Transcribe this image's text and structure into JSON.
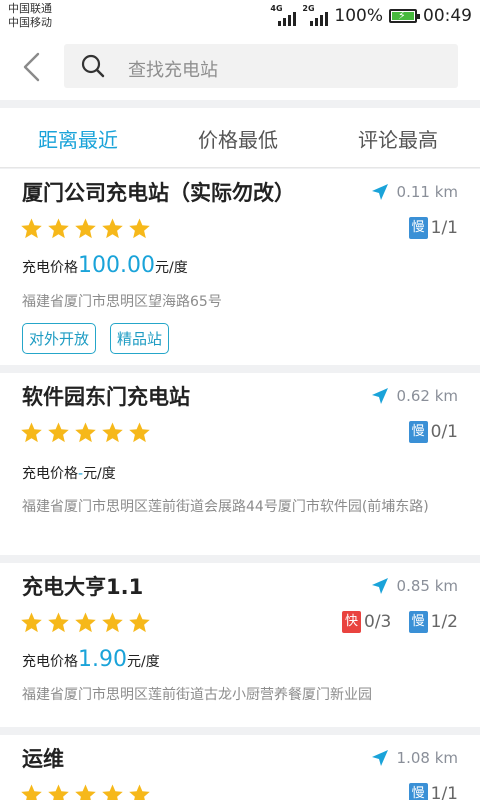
{
  "status_bar": {
    "carrier_1": "中国联通",
    "carrier_2": "中国移动",
    "net_1": "4G",
    "net_2": "2G",
    "battery": "100%",
    "time": "00:49"
  },
  "header": {
    "search_placeholder": "查找充电站"
  },
  "tabs": [
    "距离最近",
    "价格最低",
    "评论最高"
  ],
  "colors": {
    "accent": "#1aa3d9",
    "star": "#f6b81a",
    "slow": "#3a90d6",
    "fast": "#e9433f"
  },
  "stations": [
    {
      "name": "厦门公司充电站（实际勿改）",
      "distance": "0.11 km",
      "rating": 5,
      "slow_label": "慢",
      "slow_count": "1/1",
      "price_label": "充电价格",
      "price_value": "100.00",
      "price_unit": "元/度",
      "address": "福建省厦门市思明区望海路65号",
      "tags": [
        "对外开放",
        "精品站"
      ]
    },
    {
      "name": "软件园东门充电站",
      "distance": "0.62 km",
      "rating": 5,
      "slow_label": "慢",
      "slow_count": "0/1",
      "price_label": "充电价格",
      "price_value": "-",
      "price_unit": "元/度",
      "address": "福建省厦门市思明区莲前街道会展路44号厦门市软件园(前埔东路)"
    },
    {
      "name": "充电大亨1.1",
      "distance": "0.85 km",
      "rating": 5,
      "fast_label": "快",
      "fast_count": "0/3",
      "slow_label": "慢",
      "slow_count": "1/2",
      "price_label": "充电价格",
      "price_value": "1.90",
      "price_unit": "元/度",
      "address": "福建省厦门市思明区莲前街道古龙小厨营养餐厦门新业园"
    },
    {
      "name": "运维",
      "distance": "1.08 km",
      "rating": 5,
      "slow_label": "慢",
      "slow_count": "1/1"
    }
  ]
}
